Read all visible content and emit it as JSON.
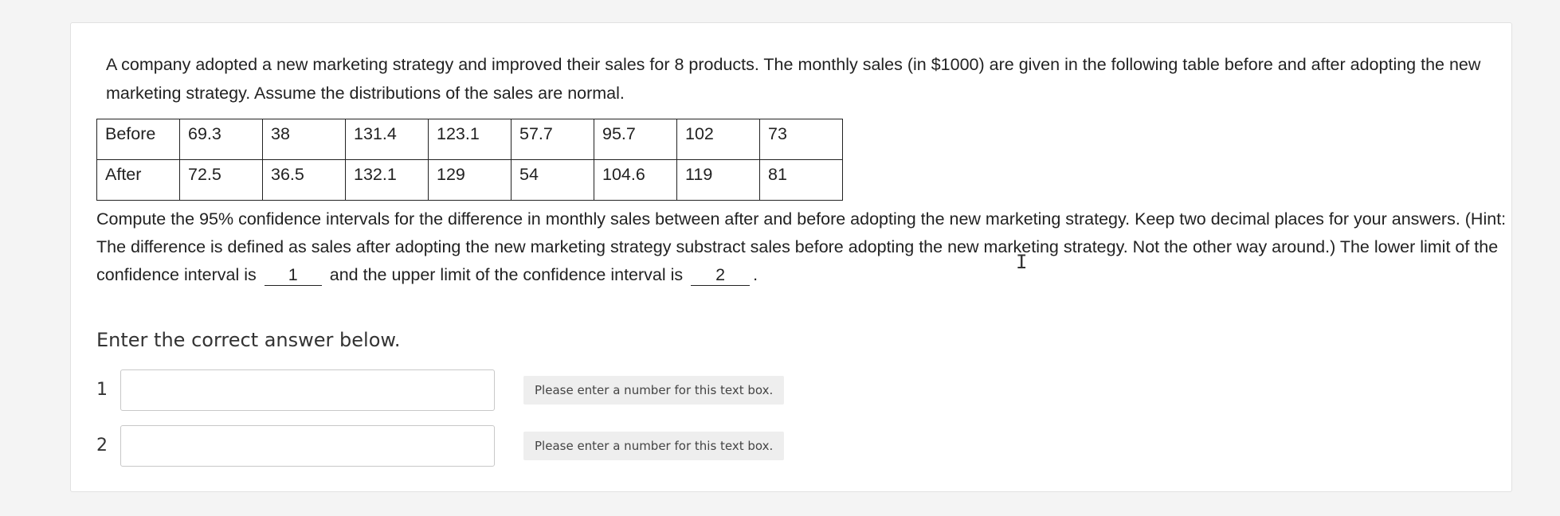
{
  "problem": {
    "intro": "A company adopted a new marketing strategy and improved their sales for 8 products. The monthly sales (in $1000) are given in the following table before and after adopting the new marketing strategy. Assume the distributions of the sales are normal.",
    "table": [
      [
        "Before",
        "69.3",
        "38",
        "131.4",
        "123.1",
        "57.7",
        "95.7",
        "102",
        "73"
      ],
      [
        "After",
        "72.5",
        "36.5",
        "132.1",
        "129",
        "54",
        "104.6",
        "119",
        "81"
      ]
    ],
    "question_part1": "Compute the 95% confidence intervals for the difference in monthly sales between after and before adopting the new marketing strategy. Keep two decimal places for your answers. (Hint: The difference is defined as sales after adopting the new marketing strategy substract sales before adopting the new marketing strategy. Not the other way around.) The lower limit of the confidence interval is",
    "blank1": "1",
    "question_part2": "and the upper limit of the confidence interval is",
    "blank2": "2",
    "question_end": "."
  },
  "answers": {
    "instruction": "Enter the correct answer below.",
    "rows": [
      {
        "number": "1",
        "value": "",
        "hint": "Please enter a number for this text box."
      },
      {
        "number": "2",
        "value": "",
        "hint": "Please enter a number for this text box."
      }
    ]
  }
}
